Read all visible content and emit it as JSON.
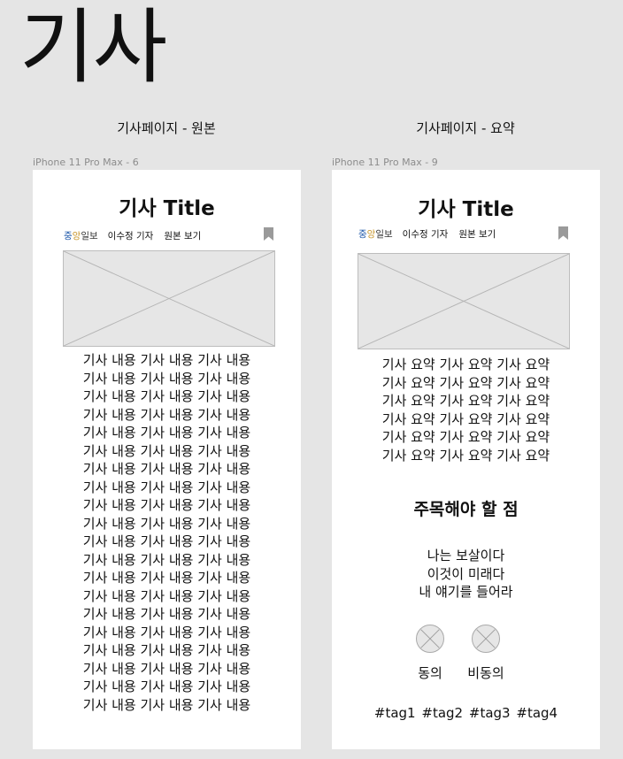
{
  "page": {
    "title": "기사"
  },
  "frames": [
    {
      "heading": "기사페이지 - 원본",
      "device": "iPhone 11 Pro Max - 6",
      "article": {
        "title": "기사 Title",
        "source": {
          "part1": "중",
          "part2": "앙",
          "part3": "일보"
        },
        "reporter": "이수정 기자",
        "view_original": "원본 보기",
        "icons": {
          "bookmark": "bookmark-icon",
          "image": "image-placeholder"
        },
        "body_lines": [
          "기사 내용 기사 내용 기사 내용",
          "기사 내용 기사 내용 기사 내용",
          "기사 내용 기사 내용 기사 내용",
          "기사 내용 기사 내용 기사 내용",
          "기사 내용 기사 내용 기사 내용",
          "기사 내용 기사 내용 기사 내용",
          "기사 내용 기사 내용 기사 내용",
          "기사 내용 기사 내용 기사 내용",
          "기사 내용 기사 내용 기사 내용",
          "기사 내용 기사 내용 기사 내용",
          "기사 내용 기사 내용 기사 내용",
          "기사 내용 기사 내용 기사 내용",
          "기사 내용 기사 내용 기사 내용",
          "기사 내용 기사 내용 기사 내용",
          "기사 내용 기사 내용 기사 내용",
          "기사 내용 기사 내용 기사 내용",
          "기사 내용 기사 내용 기사 내용",
          "기사 내용 기사 내용 기사 내용",
          "기사 내용 기사 내용 기사 내용",
          "기사 내용 기사 내용 기사 내용"
        ]
      }
    },
    {
      "heading": "기사페이지 - 요약",
      "device": "iPhone 11 Pro Max - 9",
      "article": {
        "title": "기사 Title",
        "source": {
          "part1": "중",
          "part2": "앙",
          "part3": "일보"
        },
        "reporter": "이수정 기자",
        "view_original": "원본 보기",
        "icons": {
          "bookmark": "bookmark-icon",
          "image": "image-placeholder"
        },
        "summary_lines": [
          "기사 요약 기사 요약 기사 요약",
          "기사 요약 기사 요약 기사 요약",
          "기사 요약 기사 요약 기사 요약",
          "기사 요약 기사 요약 기사 요약",
          "기사 요약 기사 요약 기사 요약",
          "기사 요약 기사 요약 기사 요약"
        ],
        "highlight_title": "주목해야 할 점",
        "highlight_lines": [
          "나는 보살이다",
          "이것이 미래다",
          "내 얘기를 들어라"
        ],
        "votes": {
          "agree": "동의",
          "disagree": "비동의"
        },
        "tags": [
          "#tag1",
          "#tag2",
          "#tag3",
          "#tag4"
        ]
      }
    }
  ]
}
